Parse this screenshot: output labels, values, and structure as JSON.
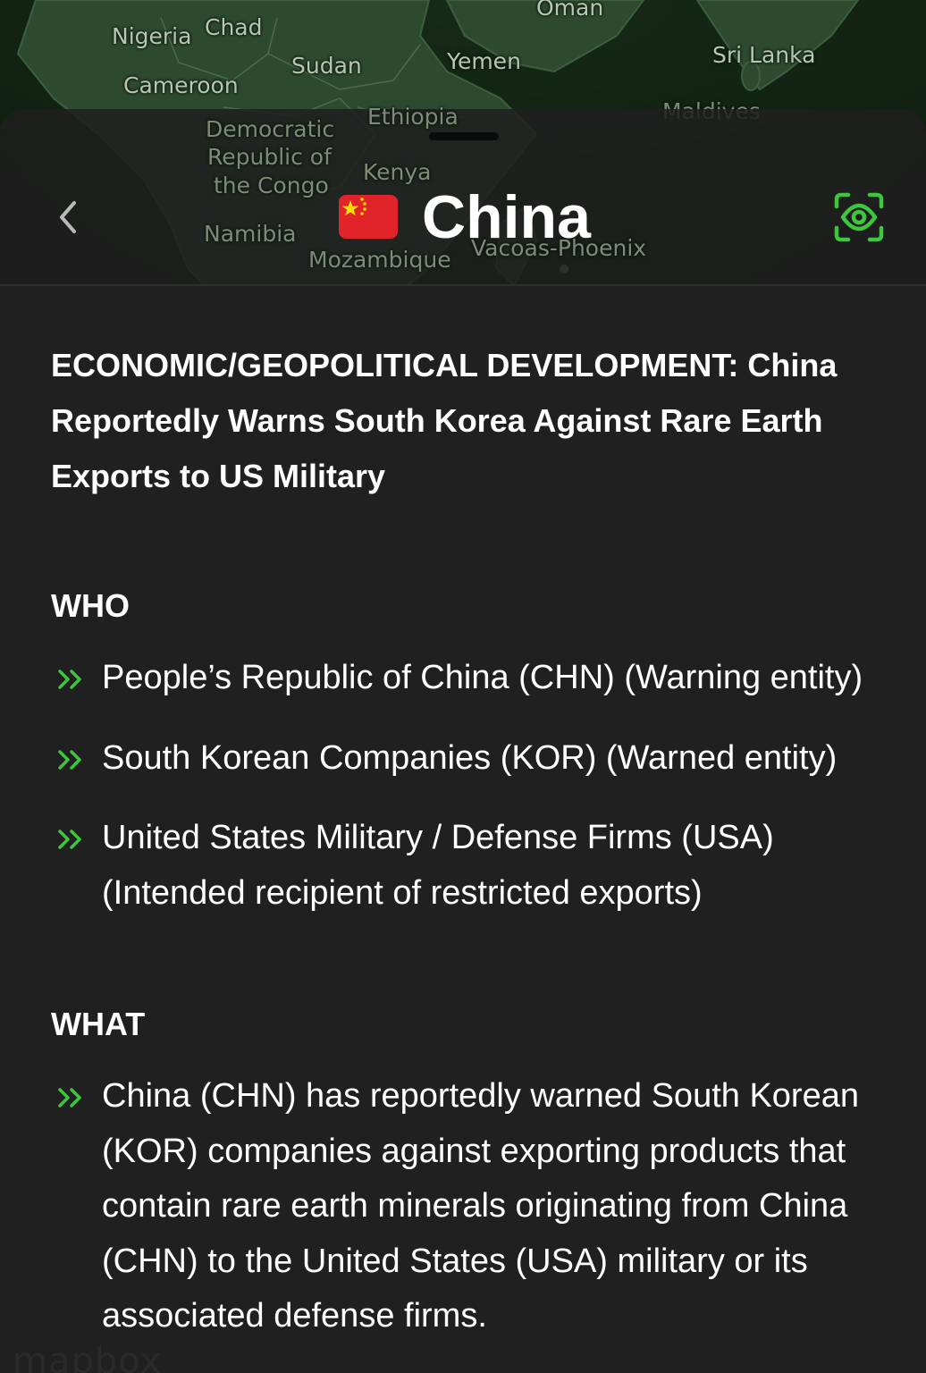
{
  "map": {
    "labels": {
      "nigeria": "Nigeria",
      "chad": "Chad",
      "sudan": "Sudan",
      "yemen": "Yemen",
      "oman": "Oman",
      "sri_lanka": "Sri Lanka",
      "cameroon": "Cameroon",
      "maldives": "Maldives",
      "drc_line1": "Democratic",
      "drc_line2": "Republic of",
      "drc_line3": "the Congo",
      "ethiopia": "Ethiopia",
      "kenya": "Kenya",
      "namibia": "Namibia",
      "mozambique": "Mozambique",
      "vacoas": "Vacoas-Phoenix"
    },
    "attribution": "mapbox",
    "land_color": "#2d4a2f",
    "ocean_color": "#0d1a0f"
  },
  "header": {
    "back_icon": "chevron-left-icon",
    "flag_icon": "china-flag-icon",
    "country": "China",
    "scan_icon": "eye-scan-icon"
  },
  "article": {
    "headline": "ECONOMIC/GEOPOLITICAL DEVELOPMENT: China Reportedly Warns South Korea Against Rare Earth Exports to US Military",
    "who": {
      "title": "WHO",
      "items": [
        "People’s Republic of China (CHN) (Warning entity)",
        "South Korean Companies (KOR) (Warned entity)",
        "United States Military / Defense Firms (USA) (Intended recipient of restricted exports)"
      ]
    },
    "what": {
      "title": "WHAT",
      "items": [
        "China (CHN) has reportedly warned South Korean (KOR) companies against exporting products that contain rare earth minerals originating from China (CHN) to the United States (USA) military or its associated defense firms."
      ]
    }
  },
  "colors": {
    "accent_green": "#3ec63e",
    "background": "#202020",
    "text": "#ffffff",
    "flag_red": "#e0242a",
    "flag_star": "#ffde00"
  }
}
